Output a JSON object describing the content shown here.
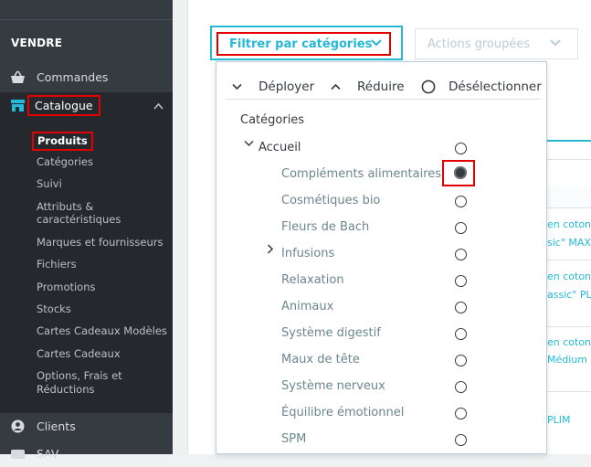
{
  "sidebar": {
    "section_title": "VENDRE",
    "commandes": "Commandes",
    "catalogue": "Catalogue",
    "submenu": [
      "Produits",
      "Catégories",
      "Suivi",
      "Attributs &",
      "caractéristiques",
      "Marques et fournisseurs",
      "Fichiers",
      "Promotions",
      "Stocks",
      "Cartes Cadeaux Modèles",
      "Cartes Cadeaux",
      "Options, Frais et",
      "Réductions"
    ],
    "clients": "Clients",
    "sav": "SAV"
  },
  "toolbar": {
    "filter_label": "Filtrer par catégories",
    "actions_label": "Actions groupées"
  },
  "dropdown": {
    "expand": "Déployer",
    "collapse": "Réduire",
    "deselect": "Désélectionner",
    "categories_title": "Catégories",
    "root": "Accueil",
    "children": [
      "Compléments alimentaires",
      "Cosmétiques bio",
      "Fleurs de Bach",
      "Infusions",
      "Relaxation",
      "Animaux",
      "Système digestif",
      "Maux de tête",
      "Système nerveux",
      "Équilibre émotionnel",
      "SPM"
    ],
    "selected": "Compléments alimentaires"
  },
  "table_fragments": [
    "en coton",
    "sic\" MAX-",
    "en coton",
    "assic\" PL",
    "en coton",
    "Médium -",
    "PLIM"
  ],
  "colors": {
    "accent": "#25b9d7",
    "highlight": "#e30000",
    "sidebar": "#363a41"
  }
}
